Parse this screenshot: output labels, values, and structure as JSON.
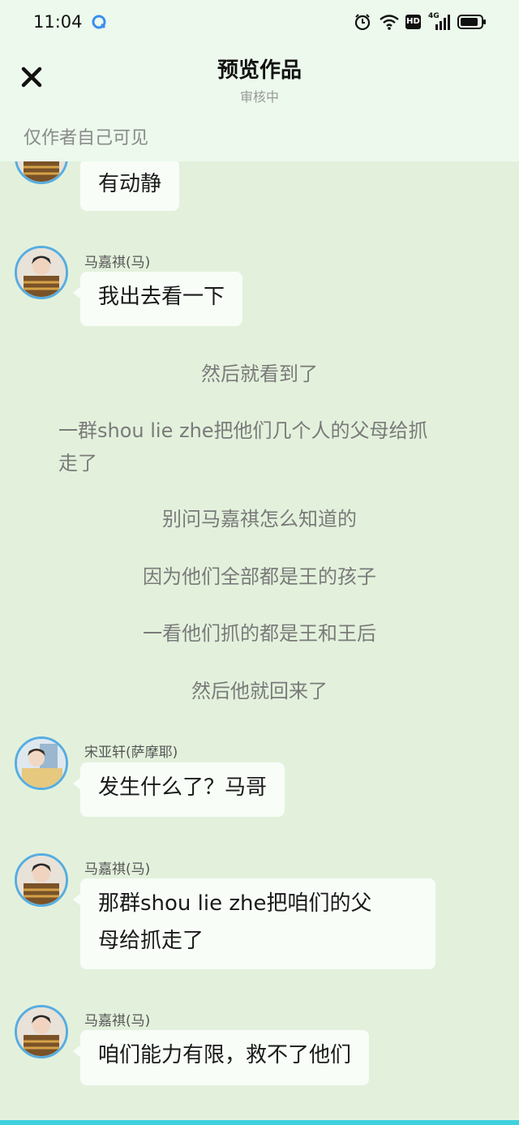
{
  "status": {
    "time": "11:04",
    "hd_label": "HD",
    "network_label": "4G"
  },
  "header": {
    "title": "预览作品",
    "subtitle": "审核中",
    "notice": "仅作者自己可见"
  },
  "messages": [
    {
      "text": "有动静"
    },
    {
      "name": "马嘉祺(马)",
      "text": "我出去看一下"
    },
    {
      "name": "宋亚轩(萨摩耶)",
      "text": "发生什么了？马哥"
    },
    {
      "name": "马嘉祺(马)",
      "text_lines": [
        "那群shou lie zhe把咱们的父",
        "母给抓走了"
      ]
    },
    {
      "name": "马嘉祺(马)",
      "text": "咱们能力有限，救不了他们"
    }
  ],
  "narration": [
    "然后就看到了",
    "一群shou lie zhe把他们几个人的父母给抓",
    "走了",
    "别问马嘉祺怎么知道的",
    "因为他们全部都是王的孩子",
    "一看他们抓的都是王和王后",
    "然后他就回来了"
  ],
  "colors": {
    "background": "#e3f1dc",
    "header_bg": "#ecf9ec",
    "avatar_border": "#57ade0",
    "bubble_bg": "#f8fdf8",
    "bottom_bar": "#3fd0de"
  }
}
